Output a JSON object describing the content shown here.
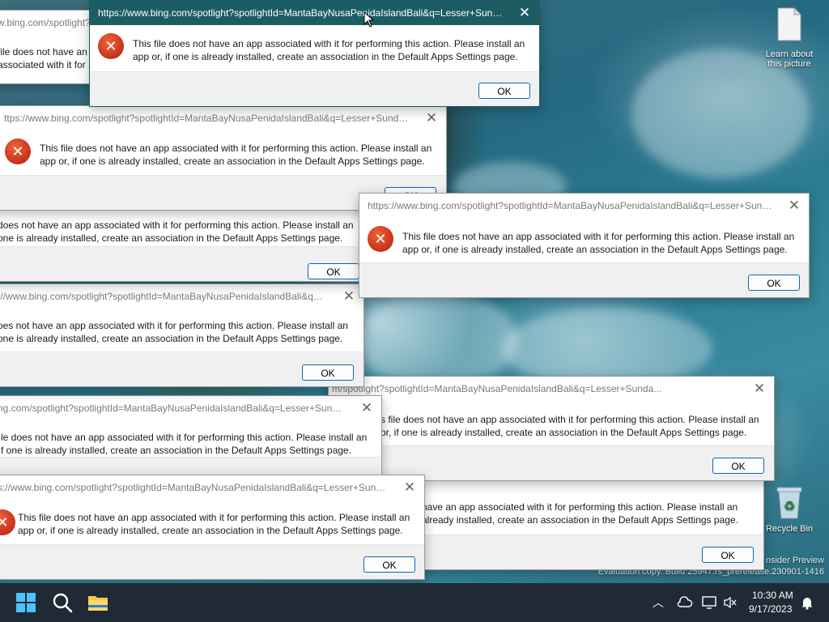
{
  "dialog_title_full": "https://www.bing.com/spotlight?spotlightId=MantaBayNusaPenidaIslandBali&q=Lesser+Sunda...",
  "dialog_title_b": "https://www.bing.com/spotlight?spotlightId=MantaBayNusaPenidaIslandBali&q=Lesser+Sunda...",
  "dialog_title_c": "://www.bing.com/spotlight?spotlightId=MantaBayNusaPenidaIslandBali&q=Lesser+Sunda...",
  "dialog_title_d": "s://www.bing.com/spotlight?spotlightId=MantaBayNusaPenidaIslandBali&q=Lesser+Sunda...",
  "dialog_title_e": "m/spotlight?spotlightId=MantaBayNusaPenidaIslandBali&q=Lesser+Sunda...",
  "dialog_title_f": "ng.com/spotlight?spotlightId=MantaBayNusaPenidaIslandBali&q=Lesser+Sunda...",
  "dialog_title_g": "w.bing.com/spotlight?spotlightId=MantaBayNusaPenidaIslandBali&q=Lesser+Sunda...",
  "dialog_title_h": "ttps://www.bing.com/spotlight?spotlightId=MantaBayNusaPenidaIslandBali&q=Lesser+Sunda...",
  "dialog_title_i": "https://www.bing.com/spotlight?spotlightId=MantaBayNusaPenidaIslandBali&q=Lesser+Sunda...",
  "message": "This file does not have an app associated with it for performing this action. Please install an app or, if one is already installed, create an association in the Default Apps Settings page.",
  "message_cut1": "file does not have an app associated with it for performing this action. Please install an or, if one is already installed, create an association in the Default Apps Settings page.",
  "message_cut2": "does not have an app associated with it for performing this action. Please install an one is already installed, create an association in the Default Apps Settings page.",
  "message_cut3": "oes not have an app associated with it for performing this action. Please install an one is already installed, create an association in the Default Apps Settings page.",
  "message_cut4": "le does not have an app associated with it for performing this action. Please install an f one is already installed, create an association in the Default Apps Settings page.",
  "message_cut5": "have an app associated with it for performing this action. Please install an already installed, create an association in the Default Apps Settings page.",
  "message_cut6": "s file does not have an app associated with it for performing this action. Please install an or, if one is already installed, create an association in the Default Apps Settings page.",
  "ok_label": "OK",
  "close_glyph": "✕",
  "error_glyph": "✕",
  "desktop": {
    "learn_label": "Learn about this picture",
    "recycle_label": "Recycle Bin",
    "watermark_line1": "nsider Preview",
    "watermark_line2": "Evaluation copy. Build 25947.rs_prerelease.230901-1416"
  },
  "taskbar": {
    "time": "10:30 AM",
    "date": "9/17/2023",
    "chevron": "︿"
  },
  "colors": {
    "active_titlebar": "#1c5d63",
    "error_red": "#d4391e",
    "ok_border": "#0a64c4",
    "taskbar_bg": "#1f2a36"
  }
}
